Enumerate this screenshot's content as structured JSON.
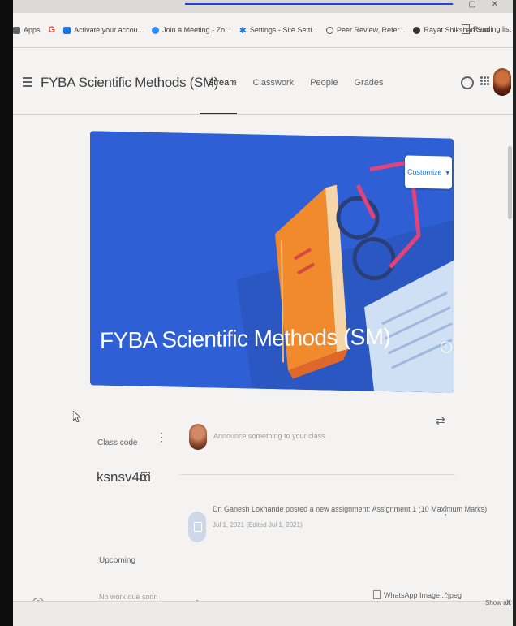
{
  "bookmarks": [
    {
      "label": "Apps",
      "icon": "apps-grid-icon",
      "color": "#5f6368"
    },
    {
      "label": "",
      "icon": "google-icon",
      "color": "#db4437"
    },
    {
      "label": "Activate your accou...",
      "icon": "bookmark-icon",
      "color": "#1a73e8"
    },
    {
      "label": "Join a Meeting - Zo...",
      "icon": "zoom-icon",
      "color": "#2d8cff"
    },
    {
      "label": "Settings - Site Setti...",
      "icon": "settings-icon",
      "color": "#1a73e8"
    },
    {
      "label": "Peer Review, Refer...",
      "icon": "page-icon",
      "color": "#555555"
    },
    {
      "label": "Rayat Shikshan San...",
      "icon": "globe-icon",
      "color": "#333333"
    }
  ],
  "reading_list": "Reading list",
  "header": {
    "class_title": "FYBA Scientific Methods (SM)",
    "tabs": [
      "Stream",
      "Classwork",
      "People",
      "Grades"
    ],
    "active_tab": "Stream"
  },
  "banner": {
    "title": "FYBA Scientific Methods (SM)",
    "customize_label": "Customize",
    "colors": {
      "background": "#2f5fd4",
      "book": "#f08a2c",
      "glasses": "#e2447a"
    }
  },
  "class_code": {
    "label": "Class code",
    "code": "ksnsv4m"
  },
  "announce": {
    "placeholder": "Announce something to your class"
  },
  "post": {
    "title": "Dr. Ganesh Lokhande posted a new assignment: Assignment 1 (10 Maximum Marks)",
    "date": "Jul 1, 2021 (Edited Jul 1, 2021)"
  },
  "upcoming": {
    "label": "Upcoming",
    "empty_text": "No work due soon"
  },
  "downloads": {
    "file_name": "WhatsApp Image....jpeg",
    "show_all": "Show all",
    "close": "X"
  }
}
